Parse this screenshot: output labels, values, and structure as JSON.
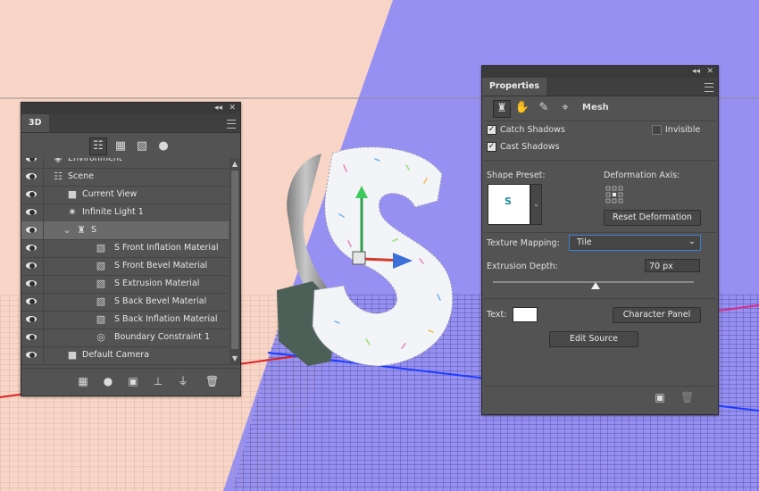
{
  "panel3d": {
    "tab": "3D",
    "layers": [
      {
        "label": "Environment",
        "icon": "environment-icon",
        "indent": 0,
        "expander": false,
        "selected": false,
        "partial": true
      },
      {
        "label": "Scene",
        "icon": "scene-icon",
        "indent": 0,
        "expander": false,
        "selected": false
      },
      {
        "label": "Current View",
        "icon": "camera-icon",
        "indent": 1,
        "expander": false,
        "selected": false
      },
      {
        "label": "Infinite Light 1",
        "icon": "light-icon",
        "indent": 1,
        "expander": false,
        "selected": false
      },
      {
        "label": "S",
        "icon": "mesh-icon",
        "indent": 1,
        "expander": true,
        "selected": true
      },
      {
        "label": "S Front Inflation Material",
        "icon": "material-icon",
        "indent": 2,
        "expander": false,
        "selected": false
      },
      {
        "label": "S Front Bevel Material",
        "icon": "material-icon",
        "indent": 2,
        "expander": false,
        "selected": false
      },
      {
        "label": "S Extrusion Material",
        "icon": "material-icon",
        "indent": 2,
        "expander": false,
        "selected": false
      },
      {
        "label": "S Back Bevel Material",
        "icon": "material-icon",
        "indent": 2,
        "expander": false,
        "selected": false
      },
      {
        "label": "S Back Inflation Material",
        "icon": "material-icon",
        "indent": 2,
        "expander": false,
        "selected": false
      },
      {
        "label": "Boundary Constraint 1",
        "icon": "constraint-icon",
        "indent": 2,
        "expander": false,
        "selected": false
      },
      {
        "label": "Default Camera",
        "icon": "camera-icon",
        "indent": 1,
        "expander": false,
        "selected": false
      }
    ]
  },
  "properties": {
    "tab": "Properties",
    "mode_label": "Mesh",
    "catch_shadows": "Catch Shadows",
    "invisible": "Invisible",
    "cast_shadows": "Cast Shadows",
    "shape_preset": "Shape Preset:",
    "deformation_axis": "Deformation Axis:",
    "reset_deformation": "Reset Deformation",
    "texture_mapping_label": "Texture Mapping:",
    "texture_mapping_value": "Tile",
    "extrusion_depth_label": "Extrusion Depth:",
    "extrusion_depth_value": "70 px",
    "extrusion_slider_fraction": 0.51,
    "text_label": "Text:",
    "character_panel": "Character Panel",
    "edit_source": "Edit Source",
    "preset_letter": "S"
  },
  "colors": {
    "background_peach": "#f8d5c7",
    "background_blue": "#9790f3",
    "panel": "#535353",
    "accent_blue": "#3a7fd5"
  }
}
